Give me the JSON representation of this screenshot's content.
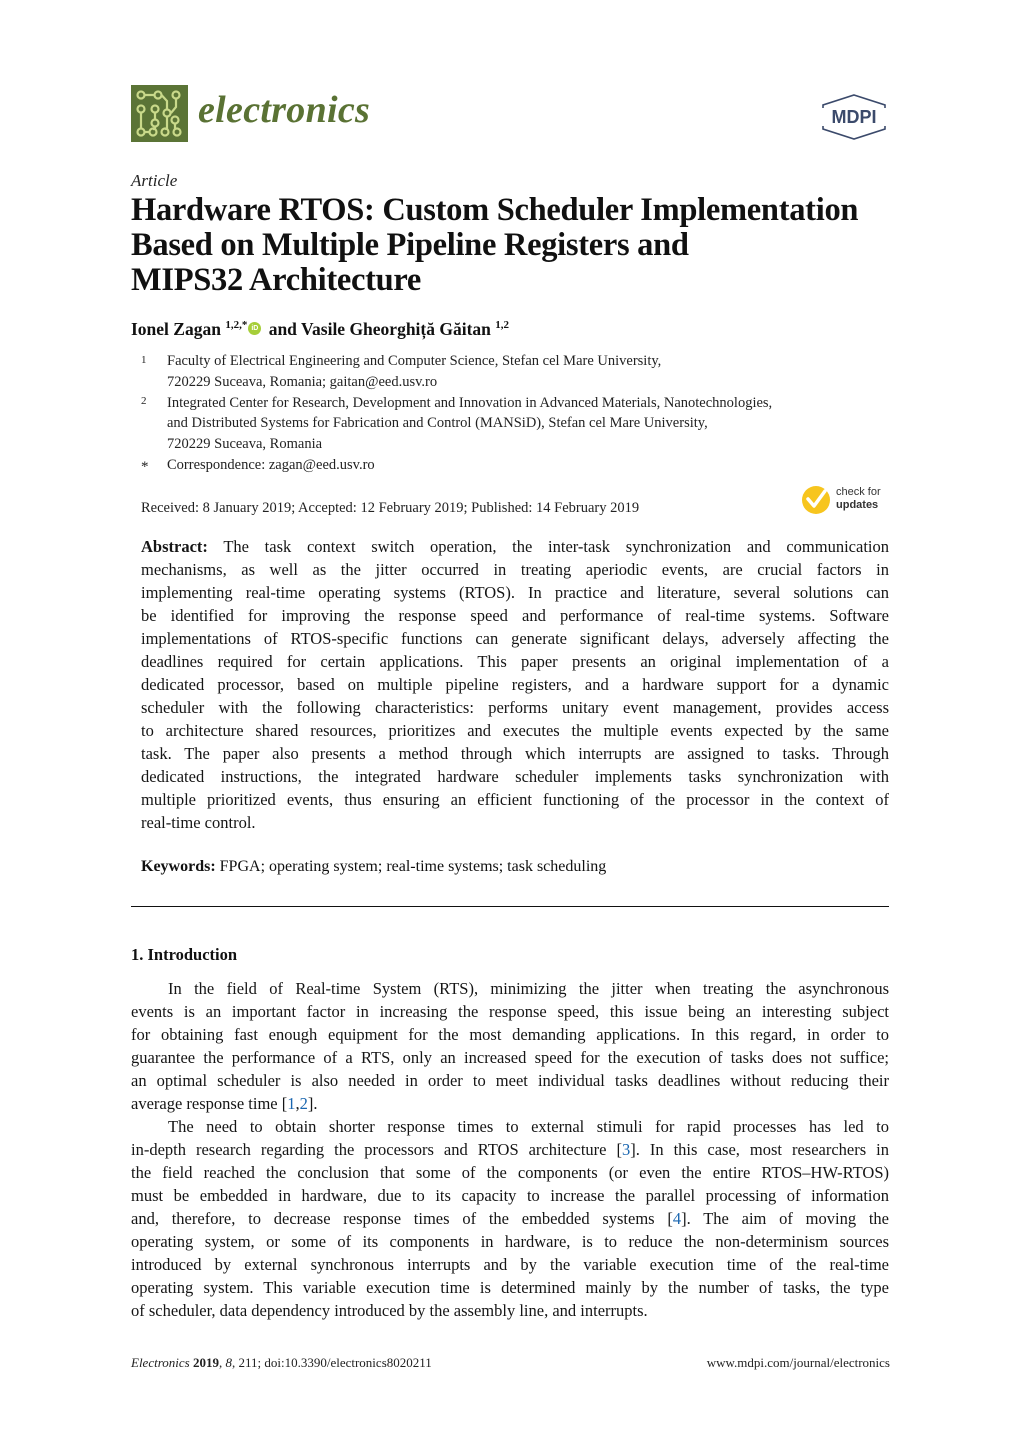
{
  "header": {
    "journal_name": "electronics",
    "publisher_logo": "MDPI",
    "logo_color": "#5b7436"
  },
  "article": {
    "type": "Article",
    "title_lines": [
      "Hardware RTOS: Custom Scheduler Implementation",
      "Based on Multiple Pipeline Registers and",
      "MIPS32 Architecture"
    ],
    "authors": [
      {
        "name": "Ionel Zagan",
        "affil": "1,2,*",
        "orcid_icon": "orcid-icon"
      },
      {
        "conjunction": "and"
      },
      {
        "name": "Vasile Gheorghiță Găitan",
        "affil": "1,2"
      }
    ],
    "affiliations": [
      {
        "mark": "1",
        "lines": [
          "Faculty of Electrical Engineering and Computer Science, Stefan cel Mare University,",
          "720229 Suceava, Romania; gaitan@eed.usv.ro"
        ]
      },
      {
        "mark": "2",
        "lines": [
          "Integrated Center for Research, Development and Innovation in Advanced Materials, Nanotechnologies,",
          "and Distributed Systems for Fabrication and Control (MANSiD), Stefan cel Mare University,",
          "720229 Suceava, Romania"
        ]
      },
      {
        "mark": "*",
        "lines": [
          "Correspondence: zagan@eed.usv.ro"
        ]
      }
    ],
    "dates": "Received: 8 January 2019; Accepted: 12 February 2019; Published: 14 February 2019",
    "check_updates": {
      "line1": "check for",
      "line2": "updates",
      "color": "#f7c51e"
    }
  },
  "abstract": {
    "label": "Abstract:",
    "lines": [
      " The task context switch operation, the inter-task synchronization and communication",
      "mechanisms, as well as the jitter occurred in treating aperiodic events, are crucial factors in",
      "implementing real-time operating systems (RTOS). In practice and literature, several solutions can",
      "be identified for improving the response speed and performance of real-time systems. Software",
      "implementations of RTOS-specific functions can generate significant delays, adversely affecting the",
      "deadlines required for certain applications. This paper presents an original implementation of a",
      "dedicated processor, based on multiple pipeline registers, and a hardware support for a dynamic",
      "scheduler with the following characteristics: performs unitary event management, provides access",
      "to architecture shared resources, prioritizes and executes the multiple events expected by the same",
      "task. The paper also presents a method through which interrupts are assigned to tasks. Through",
      "dedicated instructions, the integrated hardware scheduler implements tasks synchronization with",
      "multiple prioritized events, thus ensuring an efficient functioning of the processor in the context of",
      "real-time control."
    ]
  },
  "keywords": {
    "label": "Keywords:",
    "text": " FPGA; operating system; real-time systems; task scheduling"
  },
  "section": {
    "heading": "1. Introduction",
    "paragraph1": [
      {
        "text": "In the field of Real-time System (RTS), minimizing the jitter when treating the asynchronous"
      },
      {
        "text": "events is an important factor in increasing the response speed, this issue being an interesting subject"
      },
      {
        "text": "for obtaining fast enough equipment for the most demanding applications. In this regard, in order to"
      },
      {
        "text": "guarantee the performance of a RTS, only an increased speed for the execution of tasks does not suffice;"
      },
      {
        "text": "an optimal scheduler is also needed in order to meet individual tasks deadlines without reducing their"
      },
      {
        "pre": "average response time [",
        "cite1": "1",
        "mid": ",",
        "cite2": "2",
        "post": "]."
      }
    ],
    "paragraph2": [
      {
        "text": "The need to obtain shorter response times to external stimuli for rapid processes has led to"
      },
      {
        "pre": "in-depth research regarding the processors and RTOS architecture [",
        "cite": "3",
        "post": "]. In this case, most researchers in"
      },
      {
        "text": "the field reached the conclusion that some of the components (or even the entire RTOS–HW-RTOS)"
      },
      {
        "text": "must be embedded in hardware, due to its capacity to increase the parallel processing of information"
      },
      {
        "pre": "and, therefore, to decrease response times of the embedded systems [",
        "cite": "4",
        "post": "].  The aim of moving the"
      },
      {
        "text": "operating system, or some of its components in hardware, is to reduce the non-determinism sources"
      },
      {
        "text": "introduced by external synchronous interrupts and by the variable execution time of the real-time"
      },
      {
        "text": "operating system. This variable execution time is determined mainly by the number of tasks, the type"
      },
      {
        "text": "of scheduler, data dependency introduced by the assembly line, and interrupts."
      }
    ]
  },
  "footer": {
    "journal": "Electronics",
    "year": "2019",
    "volume": "8",
    "rest": ", 211; doi:10.3390/electronics8020211",
    "url": "www.mdpi.com/journal/electronics"
  }
}
